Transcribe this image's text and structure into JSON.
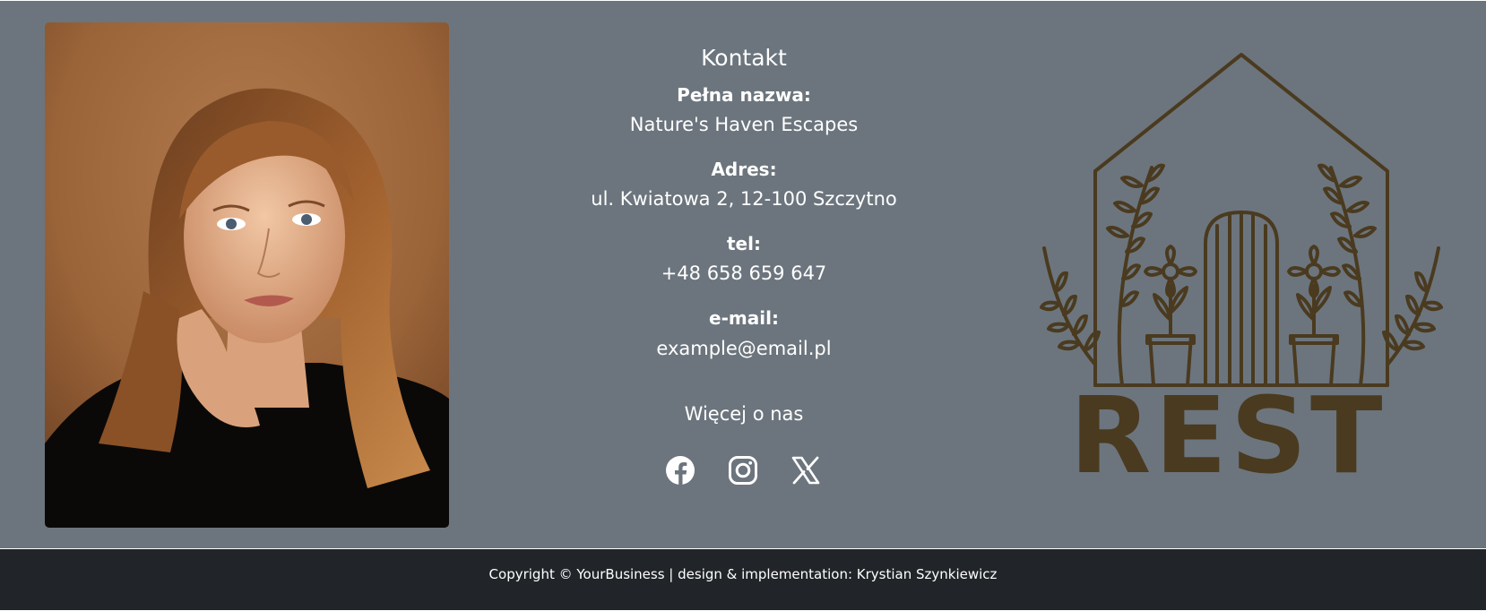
{
  "contact": {
    "title": "Kontakt",
    "name_label": "Pełna nazwa:",
    "name_value": "Nature's Haven Escapes",
    "address_label": "Adres:",
    "address_value": "ul. Kwiatowa 2, 12-100 Szczytno",
    "phone_label": "tel:",
    "phone_value": "+48 658 659 647",
    "email_label": "e-mail:",
    "email_value": "example@email.pl",
    "more_link": "Więcej o nas"
  },
  "social": [
    {
      "icon": "facebook-icon"
    },
    {
      "icon": "instagram-icon"
    },
    {
      "icon": "x-twitter-icon"
    }
  ],
  "logo": {
    "text": "REST",
    "color": "#4a3a1f"
  },
  "footer": {
    "copyright": "Copyright © YourBusiness | design & implementation: Krystian Szynkiewicz"
  },
  "colors": {
    "section_bg": "#6c757d",
    "footer_bg": "#212529",
    "text": "#ffffff"
  }
}
